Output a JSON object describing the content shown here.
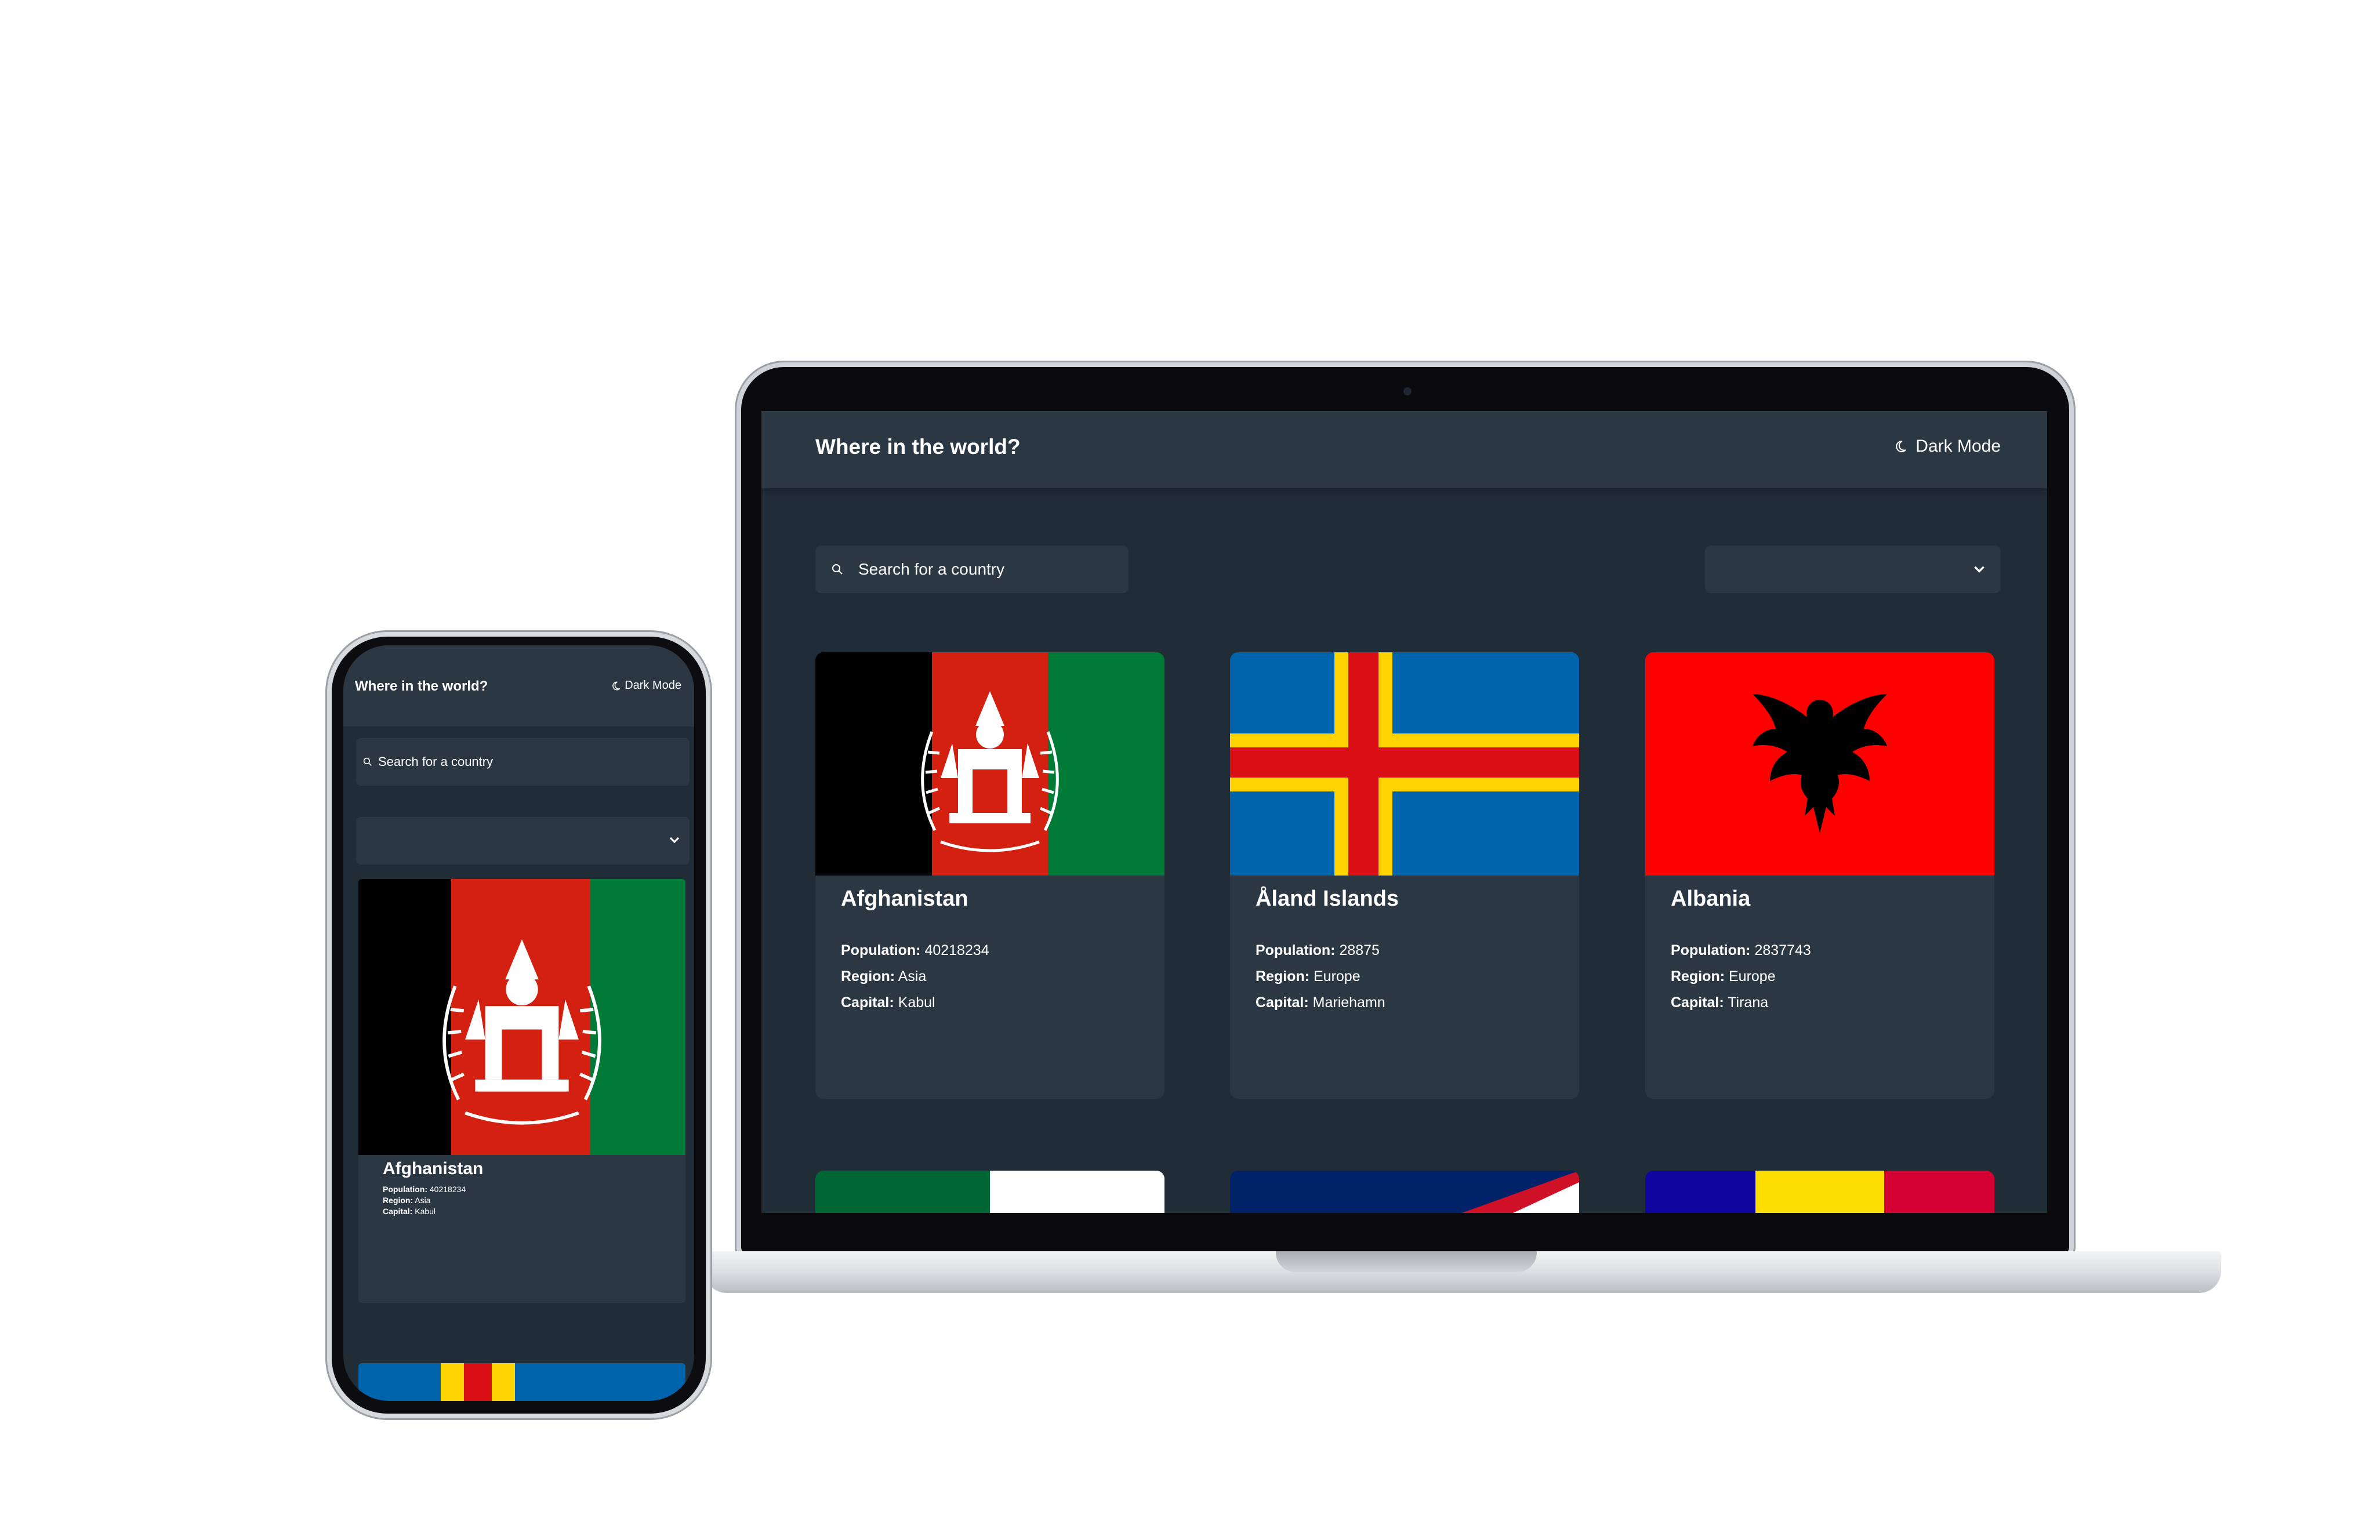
{
  "app": {
    "title": "Where in the world?",
    "theme_toggle_label": "Dark Mode",
    "search_placeholder": "Search for a country"
  },
  "labels": {
    "population": "Population:",
    "region": "Region:",
    "capital": "Capital:"
  },
  "countries": [
    {
      "name": "Afghanistan",
      "population": "40218234",
      "region": "Asia",
      "capital": "Kabul"
    },
    {
      "name": "Åland Islands",
      "population": "28875",
      "region": "Europe",
      "capital": "Mariehamn"
    },
    {
      "name": "Albania",
      "population": "2837743",
      "region": "Europe",
      "capital": "Tirana"
    }
  ],
  "colors": {
    "background": "#202c36",
    "surface": "#2b3844",
    "text": "#ffffff"
  },
  "icons": [
    "moon-icon",
    "search-icon",
    "chevron-down-icon"
  ]
}
